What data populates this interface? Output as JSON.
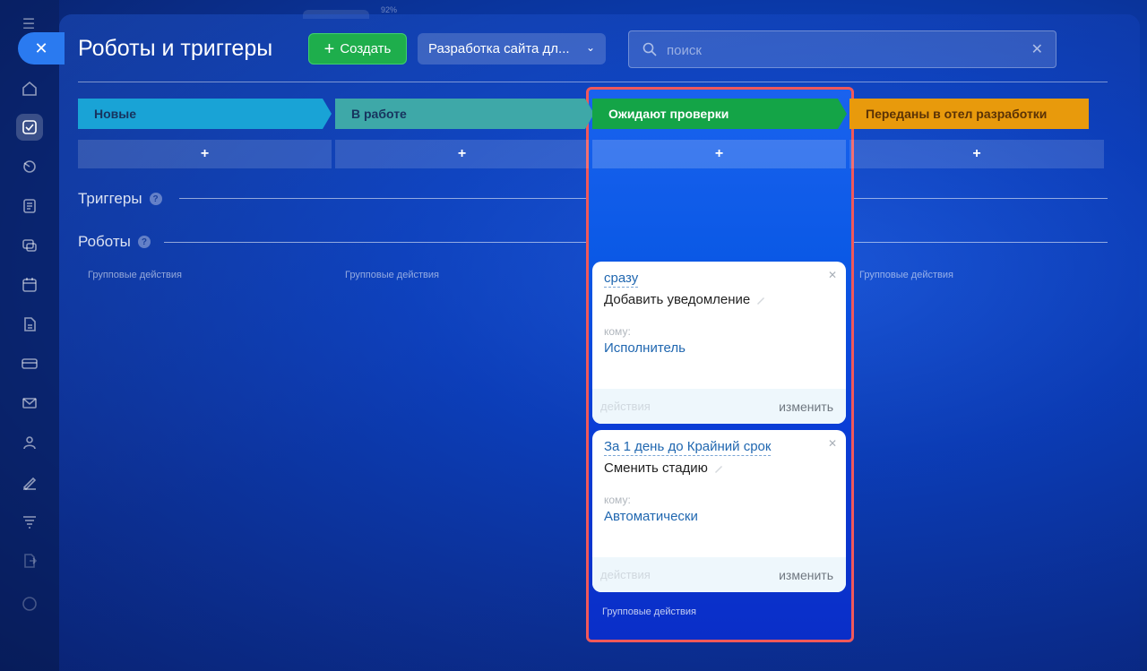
{
  "app": {
    "title": "Роботы и триггеры",
    "create_label": "Создать",
    "pipeline": "Разработка сайта дл...",
    "search_placeholder": "поиск",
    "top_percent": "92%"
  },
  "stages": [
    {
      "label": "Новые"
    },
    {
      "label": "В работе"
    },
    {
      "label": "Ожидают проверки"
    },
    {
      "label": "Переданы в отел разработки"
    }
  ],
  "add_symbol": "+",
  "sections": {
    "triggers": "Триггеры",
    "robots": "Роботы",
    "help": "?"
  },
  "group_actions": "Групповые действия",
  "robots": [
    {
      "when": "сразу",
      "action": "Добавить уведомление",
      "to_label": "кому:",
      "to_value": "Исполнитель",
      "footer_actions": "действия",
      "footer_edit": "изменить"
    },
    {
      "when": "За 1 день до Крайний срок",
      "action": "Сменить стадию",
      "to_label": "кому:",
      "to_value": "Автоматически",
      "footer_actions": "действия",
      "footer_edit": "изменить"
    }
  ],
  "colors": {
    "stage_new": "#19a3d6",
    "stage_work": "#3ea8a8",
    "stage_wait": "#14a447",
    "stage_dev": "#e89a0c",
    "highlight_border": "#f0585a",
    "create_button": "#1eae4c"
  },
  "icons": [
    "menu-icon",
    "close-icon",
    "home-icon",
    "tasks-icon",
    "crm-icon",
    "docs-icon",
    "chat-icon",
    "calendar-icon",
    "file-icon",
    "card-icon",
    "mail-icon",
    "users-icon",
    "sign-icon",
    "filter-icon",
    "export-icon",
    "circle-icon",
    "search-icon",
    "chevron-down-icon",
    "pencil-icon"
  ]
}
